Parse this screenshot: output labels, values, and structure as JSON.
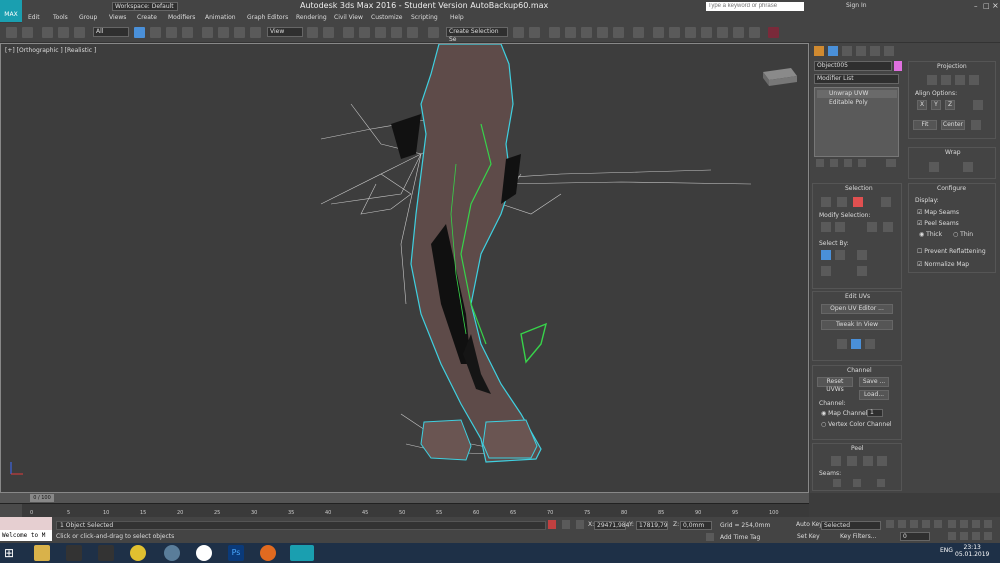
{
  "window": {
    "app_logo": "MAX",
    "title": "Autodesk 3ds Max 2016 - Student Version     AutoBackup60.max",
    "workspace": "Workspace: Default",
    "search_placeholder": "Type a keyword or phrase",
    "sign_in": "Sign In"
  },
  "menu": [
    "Edit",
    "Tools",
    "Group",
    "Views",
    "Create",
    "Modifiers",
    "Animation",
    "Graph Editors",
    "Rendering",
    "Civil View",
    "Customize",
    "Scripting",
    "Help"
  ],
  "toolbar": {
    "selection_filter": "All",
    "ref_coord": "View",
    "named_selection": "Create Selection Se"
  },
  "viewport": {
    "label": "[+] [Orthographic ] [Realistic ]"
  },
  "command_panel": {
    "object_name": "Object005",
    "object_color": "#e070e0",
    "modifier_list": "Modifier List",
    "stack": [
      "Unwrap UVW",
      "Editable Poly"
    ],
    "selection": {
      "title": "Selection",
      "modify_selection": "Modify Selection:",
      "select_by": "Select By:"
    },
    "edit_uvs": {
      "title": "Edit UVs",
      "open_uv_editor": "Open UV Editor ...",
      "tweak_in_view": "Tweak In View"
    },
    "channel": {
      "title": "Channel",
      "reset_uvws": "Reset UVWs",
      "save": "Save ...",
      "load": "Load...",
      "channel_label": "Channel:",
      "map_channel": "Map Channel:",
      "map_channel_value": "1",
      "vertex_color": "Vertex Color Channel"
    },
    "peel": {
      "title": "Peel",
      "seams": "Seams:"
    },
    "projection": {
      "title": "Projection",
      "align_options": "Align Options:",
      "axes": [
        "X",
        "Y",
        "Z"
      ],
      "fit": "Fit",
      "center": "Center"
    },
    "wrap": {
      "title": "Wrap"
    },
    "configure": {
      "title": "Configure",
      "display": "Display:",
      "map_seams": "Map Seams",
      "peel_seams": "Peel Seams",
      "thick": "Thick",
      "thin": "Thin",
      "prevent_reflattening": "Prevent Reflattening",
      "normalize_map": "Normalize Map"
    }
  },
  "timeline": {
    "frame": "0 / 100",
    "ticks": [
      "0",
      "5",
      "10",
      "15",
      "20",
      "25",
      "30",
      "35",
      "40",
      "45",
      "50",
      "55",
      "60",
      "65",
      "70",
      "75",
      "80",
      "85",
      "90",
      "95",
      "100"
    ]
  },
  "status": {
    "selection_info": "1 Object Selected",
    "prompt": "Click or click-and-drag to select objects",
    "welcome": "Welcome to M",
    "x_label": "X:",
    "x_value": "29471,984",
    "y_label": "Y:",
    "y_value": "17819,79",
    "z_label": "Z:",
    "z_value": "0,0mm",
    "grid": "Grid = 254,0mm",
    "add_time_tag": "Add Time Tag",
    "auto_key": "Auto Key",
    "set_key": "Set Key",
    "key_mode": "Selected",
    "key_filters": "Key Filters...",
    "current_frame": "0"
  },
  "taskbar": {
    "lang": "ENG",
    "time": "23:13",
    "date": "05.01.2019"
  }
}
